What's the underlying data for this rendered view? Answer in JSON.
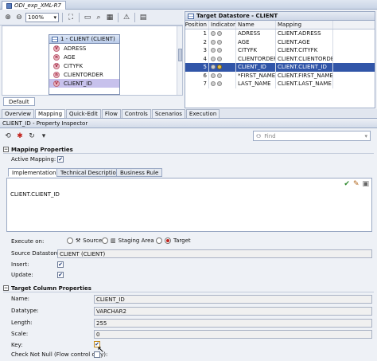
{
  "document_tab": {
    "title": "ODI_exp_XML-R7"
  },
  "toolbar": {
    "zoom_value": "100%"
  },
  "diagram": {
    "entity_title": "1 - CLIENT (CLIENT)",
    "columns": [
      {
        "icon": "V",
        "label": "ADRESS"
      },
      {
        "icon": "n",
        "label": "AGE"
      },
      {
        "icon": "V",
        "label": "CITYFK"
      },
      {
        "icon": "n",
        "label": "CLIENTORDER"
      },
      {
        "icon": "V",
        "label": "CLIENT_ID"
      }
    ],
    "selected_index": 4,
    "tab_label": "Default"
  },
  "target_datastore": {
    "title": "Target Datastore - CLIENT",
    "headers": [
      "Position",
      "Indicators",
      "Name",
      "Mapping"
    ],
    "rows": [
      {
        "pos": "1",
        "name": "ADRESS",
        "mapping": "CLIENT.ADRESS"
      },
      {
        "pos": "2",
        "name": "AGE",
        "mapping": "CLIENT.AGE"
      },
      {
        "pos": "3",
        "name": "CITYFK",
        "mapping": "CLIENT.CITYFK"
      },
      {
        "pos": "4",
        "name": "CLIENTORDER",
        "mapping": "CLIENT.CLIENTORDER"
      },
      {
        "pos": "5",
        "name": "CLIENT_ID",
        "mapping": "CLIENT.CLIENT_ID"
      },
      {
        "pos": "6",
        "name": "*FIRST_NAME",
        "mapping": "CLIENT.FIRST_NAME"
      },
      {
        "pos": "7",
        "name": "LAST_NAME",
        "mapping": "CLIENT.LAST_NAME"
      }
    ],
    "selected_index": 4
  },
  "bottom_tabs": [
    "Overview",
    "Mapping",
    "Quick-Edit",
    "Flow",
    "Controls",
    "Scenarios",
    "Execution"
  ],
  "active_bottom_tab": "Mapping",
  "inspector": {
    "title": "CLIENT_ID - Property Inspector",
    "search_placeholder": "Find",
    "mapping_section": "Mapping Properties",
    "active_mapping_label": "Active Mapping:",
    "sub_tabs": [
      "Implementation",
      "Technical Description",
      "Business Rule"
    ],
    "expression": "CLIENT.CLIENT_ID",
    "execute_on_label": "Execute on:",
    "execute_options": [
      "Source",
      "Staging Area",
      "Target"
    ],
    "execute_selected": "Target",
    "source_datastore_label": "Source Datastore:",
    "source_datastore_value": "CLIENT (CLIENT)",
    "insert_label": "Insert:",
    "update_label": "Update:",
    "target_section": "Target Column Properties",
    "name_label": "Name:",
    "name_value": "CLIENT_ID",
    "datatype_label": "Datatype:",
    "datatype_value": "VARCHAR2",
    "length_label": "Length:",
    "length_value": "255",
    "scale_label": "Scale:",
    "scale_value": "0",
    "key_label": "Key:",
    "check_not_null_label": "Check Not Null (Flow control only):"
  }
}
